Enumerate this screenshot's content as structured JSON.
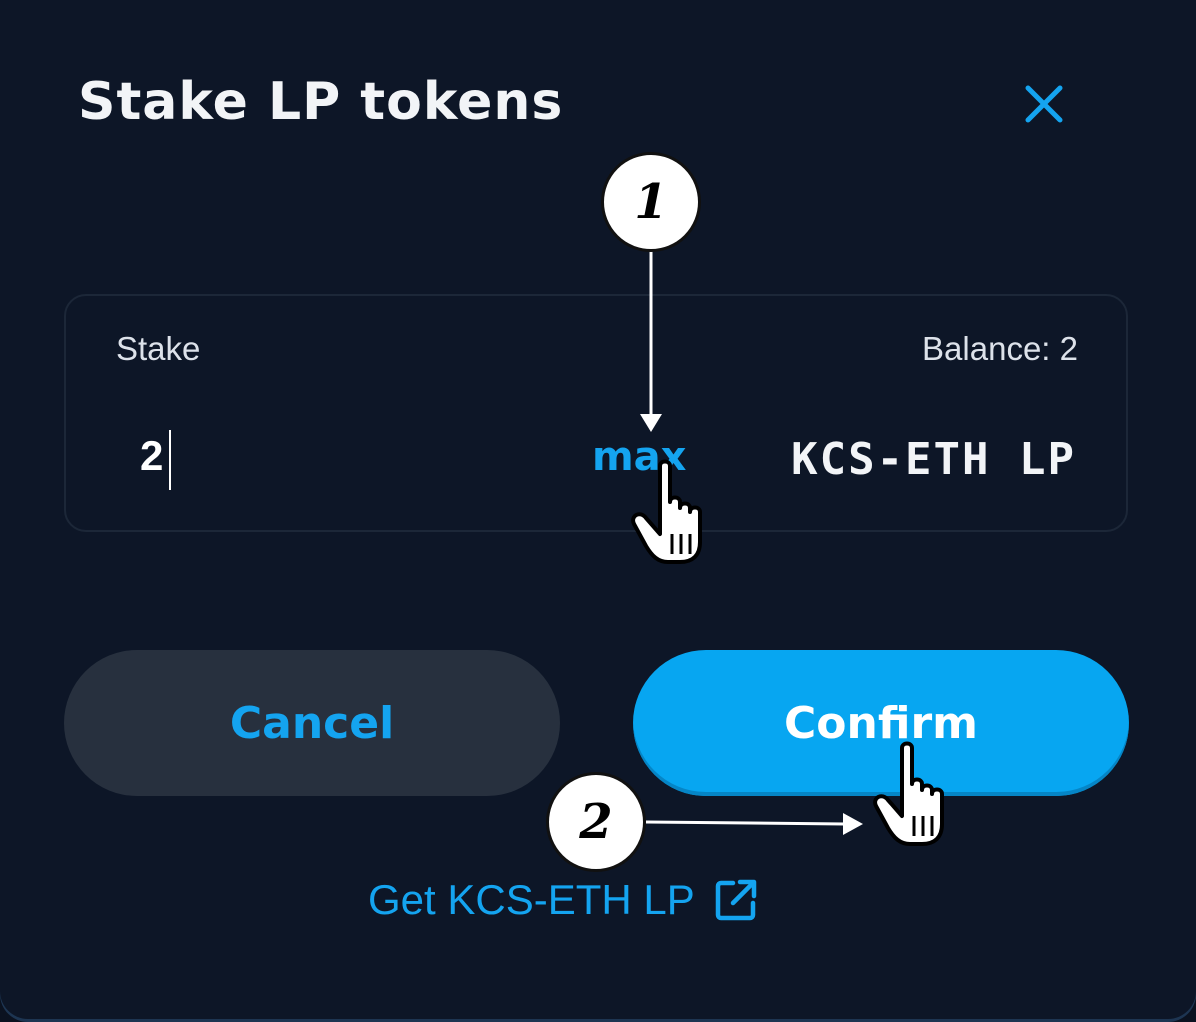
{
  "modal": {
    "title": "Stake LP tokens",
    "close_icon": "close-icon"
  },
  "stake": {
    "label": "Stake",
    "balance": "Balance: 2",
    "amount": "2",
    "max_label": "max",
    "token": "KCS-ETH LP"
  },
  "actions": {
    "cancel_label": "Cancel",
    "confirm_label": "Confirm"
  },
  "footer": {
    "get_link_label": "Get KCS-ETH LP",
    "link_icon": "external-link-icon"
  },
  "annotations": {
    "step1": "1",
    "step2": "2",
    "pointer_icon": "hand-pointer-icon"
  },
  "colors": {
    "background": "#0d1627",
    "accent": "#14a4f0",
    "confirm_bg": "#07a6f1",
    "cancel_bg": "#27303e"
  }
}
